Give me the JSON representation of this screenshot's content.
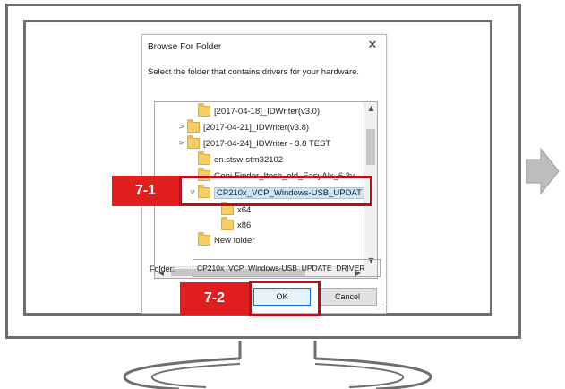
{
  "dialog": {
    "title": "Browse For Folder",
    "close_glyph": "✕",
    "instruction": "Select the folder that contains drivers for your hardware.",
    "tree_items": [
      {
        "label": "[2017-04-18]_IDWriter(v3.0)",
        "expander": "",
        "selected": false
      },
      {
        "label": "[2017-04-21]_IDWriter(v3.8)",
        "expander": ">",
        "selected": false
      },
      {
        "label": "[2017-04-24]_IDWriter - 3.8 TEST",
        "expander": ">",
        "selected": false
      },
      {
        "label": "en.stsw-stm32102",
        "expander": "",
        "selected": false
      },
      {
        "label": "Geni-Finder_Itech_old_EasyAlx_6.3v",
        "expander": "",
        "selected": false
      },
      {
        "label": "CP210x_VCP_Windows-USB_UPDAT",
        "expander": "v",
        "selected": true
      },
      {
        "label": "x64",
        "expander": "",
        "selected": false
      },
      {
        "label": "x86",
        "expander": "",
        "selected": false
      },
      {
        "label": "New folder",
        "expander": "",
        "selected": false
      }
    ],
    "folder_label": "Folder:",
    "folder_value": "CP210x_VCP_Windows-USB_UPDATE_DRIVER",
    "ok_label": "OK",
    "cancel_label": "Cancel"
  },
  "annotations": [
    {
      "badge": "7-1",
      "color": "#e01e1e"
    },
    {
      "badge": "7-2",
      "color": "#e01e1e"
    }
  ],
  "colors": {
    "monitor_outline": "#6e6e6e",
    "annotation_red": "#e01e1e",
    "selection": "#cce4f7",
    "arrow": "#bdbdbd"
  }
}
